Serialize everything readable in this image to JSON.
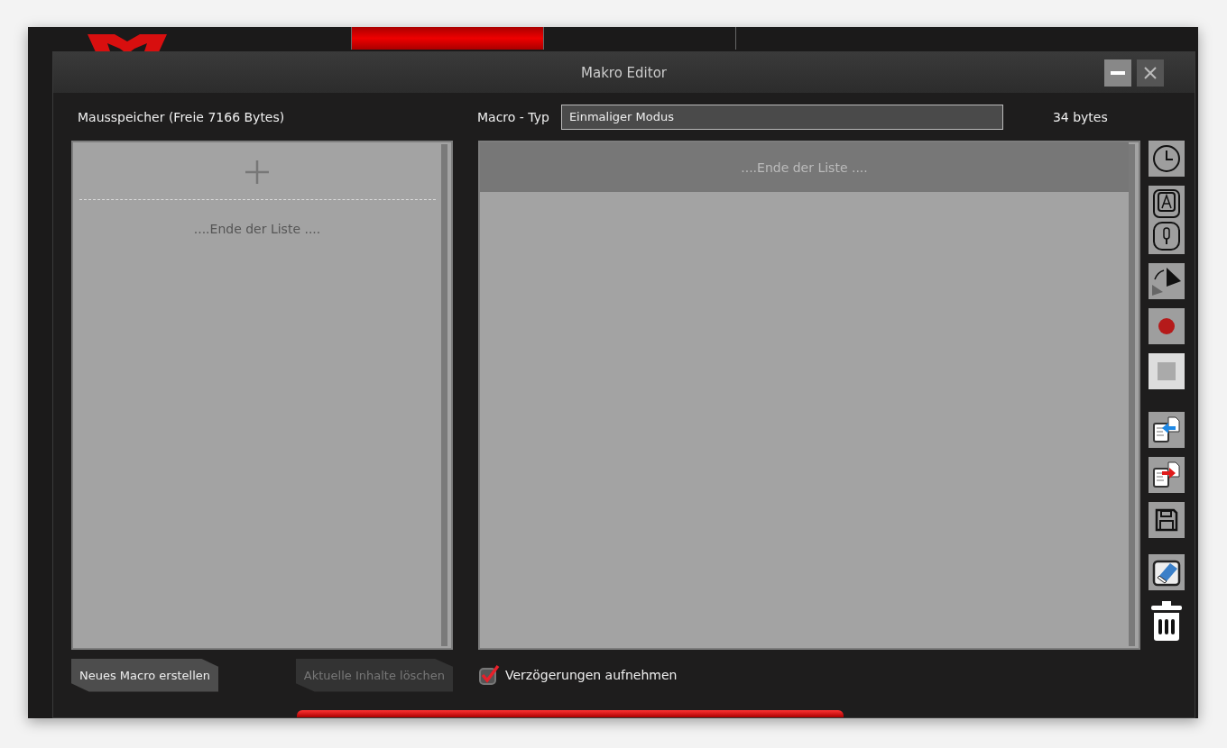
{
  "background_tabs": [
    {
      "selected": true
    },
    {
      "selected": false
    },
    {
      "selected": false
    }
  ],
  "window": {
    "title": "Makro Editor"
  },
  "memory_label": "Mausspeicher (Freie 7166 Bytes)",
  "macro_type": {
    "label": "Macro - Typ",
    "value": "Einmaliger Modus"
  },
  "size": "34 bytes",
  "macro_list": {
    "end_text": "....Ende der Liste ...."
  },
  "event_list": {
    "end_text": "....Ende der Liste ...."
  },
  "buttons": [
    {
      "label": "Neues Macro erstellen",
      "disabled": false
    },
    {
      "label": "Aktuelle Inhalte löschen",
      "disabled": true
    }
  ],
  "record_delays": {
    "label": "Verzögerungen aufnehmen",
    "checked": true
  }
}
